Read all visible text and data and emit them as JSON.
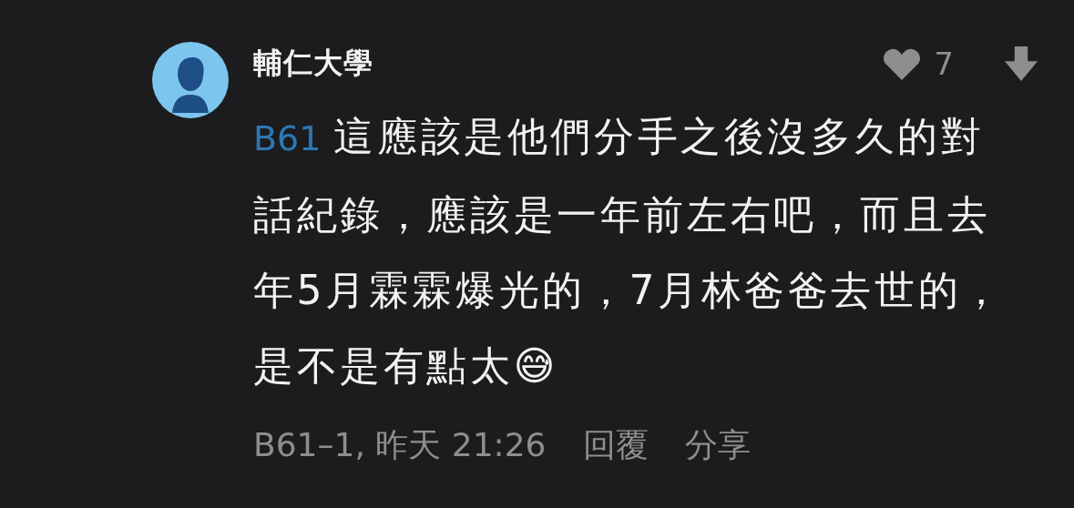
{
  "comment": {
    "author": "輔仁大學",
    "likes": "7",
    "reply_to": "B61",
    "text": "這應該是他們分手之後沒多久的對話紀錄，應該是一年前左右吧，而且去年5月霖霖爆光的，7月林爸爸去世的，是不是有點太😅",
    "floor": "B61–1, 昨天 21:26",
    "actions": [
      "回覆",
      "分享"
    ]
  }
}
